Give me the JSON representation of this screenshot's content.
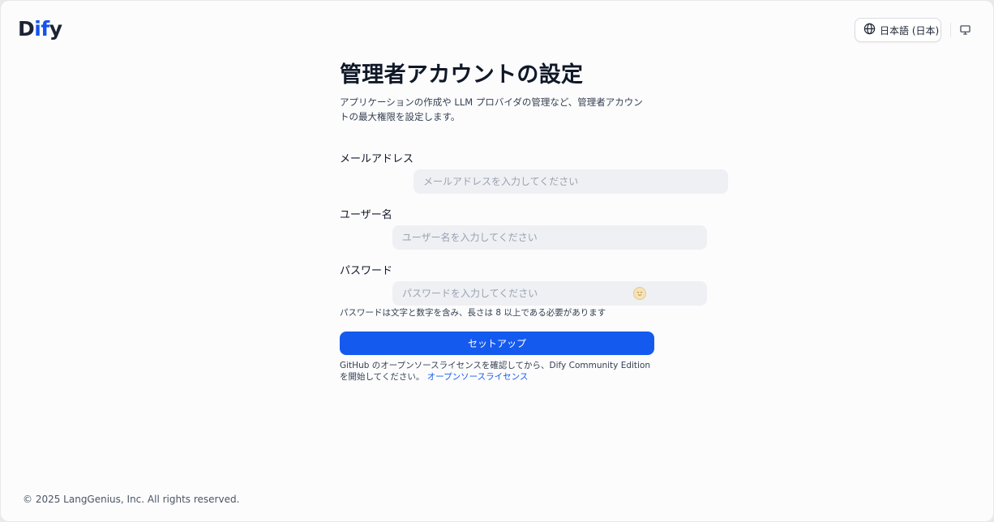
{
  "app": {
    "logo_prefix": "D",
    "logo_accent": "if",
    "logo_suffix": "y"
  },
  "header": {
    "language_label": "日本語 (日本)",
    "language_icon": "globe-icon",
    "theme_icon": "monitor-icon"
  },
  "setup": {
    "title": "管理者アカウントの設定",
    "description": "アプリケーションの作成や LLM プロバイダの管理など、管理者アカウントの最大権限を設定します。",
    "email": {
      "label": "メールアドレス",
      "placeholder": "メールアドレスを入力してください",
      "value": ""
    },
    "username": {
      "label": "ユーザー名",
      "placeholder": "ユーザー名を入力してください",
      "value": ""
    },
    "password": {
      "label": "パスワード",
      "placeholder": "パスワードを入力してください",
      "value": "",
      "hint": "パスワードは文字と数字を含み、長さは 8 以上である必要があります"
    },
    "submit_label": "セットアップ",
    "license_text": "GitHub のオープンソースライセンスを確認してから、Dify Community Edition を開始してください。",
    "license_link": "オープンソースライセンス"
  },
  "footer": {
    "copyright": "© 2025 LangGenius, Inc. All rights reserved."
  },
  "colors": {
    "accent": "#155aef",
    "background": "#fcfcfd",
    "input_bg": "#eff0f3"
  }
}
